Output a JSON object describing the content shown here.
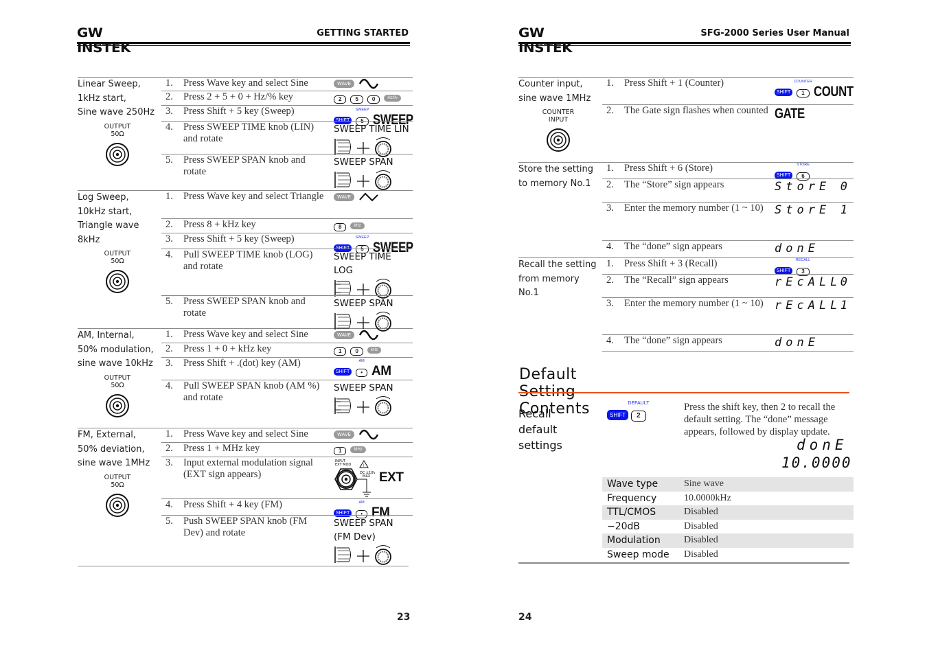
{
  "left_page": {
    "logo": "GW INSTEK",
    "header_title": "GETTING STARTED",
    "page_number": "23",
    "sections": [
      {
        "label": [
          "Linear Sweep,",
          "1kHz start,",
          "Sine wave 250Hz"
        ],
        "output": [
          "OUTPUT",
          "50Ω"
        ],
        "steps": [
          {
            "n": "1.",
            "text": "Press Wave key and select Sine",
            "icons": [
              [
                {
                  "type": "wave",
                  "label": "WAVE"
                },
                {
                  "type": "sine"
                }
              ]
            ]
          },
          {
            "n": "2.",
            "text": "Press 2 + 5 + 0 + Hz/% key",
            "icons": [
              [
                {
                  "type": "key",
                  "label": "2"
                },
                {
                  "type": "key",
                  "label": "5"
                },
                {
                  "type": "key",
                  "label": "0"
                },
                {
                  "type": "unit",
                  "label": "Hz/%"
                }
              ]
            ]
          },
          {
            "n": "3.",
            "text": "Press Shift + 5 key (Sweep)",
            "icons": [
              [
                {
                  "type": "shift",
                  "label": "SHIFT"
                },
                {
                  "type": "key",
                  "label": "5",
                  "above": "SWEEP"
                },
                {
                  "type": "big",
                  "label": "SWEEP"
                }
              ]
            ]
          },
          {
            "n": "4.",
            "text": "Press SWEEP TIME knob (LIN) and rotate",
            "icons": [
              [
                {
                  "type": "text",
                  "label": "SWEEP TIME LIN"
                }
              ],
              [
                {
                  "type": "knob"
                }
              ]
            ]
          },
          {
            "n": "5.",
            "text": "Press SWEEP SPAN knob and rotate",
            "icons": [
              [
                {
                  "type": "text",
                  "label": "SWEEP SPAN"
                }
              ],
              [
                {
                  "type": "knob"
                }
              ]
            ]
          }
        ]
      },
      {
        "label": [
          "Log Sweep,",
          "10kHz start,",
          "Triangle wave",
          "8kHz"
        ],
        "output": [
          "OUTPUT",
          "50Ω"
        ],
        "steps": [
          {
            "n": "1.",
            "text": "Press Wave key and select Triangle",
            "icons": [
              [
                {
                  "type": "wave",
                  "label": "WAVE"
                },
                {
                  "type": "triangle"
                }
              ]
            ]
          },
          {
            "n": "2.",
            "text": "Press 8 + kHz key",
            "icons": [
              [
                {
                  "type": "key",
                  "label": "8"
                },
                {
                  "type": "unit",
                  "label": "kHz"
                }
              ]
            ]
          },
          {
            "n": "3.",
            "text": "Press Shift + 5 key (Sweep)",
            "icons": [
              [
                {
                  "type": "shift",
                  "label": "SHIFT"
                },
                {
                  "type": "key",
                  "label": "5",
                  "above": "SWEEP"
                },
                {
                  "type": "big",
                  "label": "SWEEP"
                }
              ]
            ]
          },
          {
            "n": "4.",
            "text": "Pull SWEEP TIME knob (LOG) and rotate",
            "icons": [
              [
                {
                  "type": "text",
                  "label": "SWEEP TIME"
                }
              ],
              [
                {
                  "type": "text",
                  "label": "LOG"
                }
              ],
              [
                {
                  "type": "knob-pull"
                }
              ]
            ]
          },
          {
            "n": "5.",
            "text": "Press SWEEP SPAN knob and rotate",
            "icons": [
              [
                {
                  "type": "text",
                  "label": "SWEEP SPAN"
                }
              ],
              [
                {
                  "type": "knob"
                }
              ]
            ]
          }
        ]
      },
      {
        "label": [
          "AM, Internal,",
          "50% modulation,",
          "sine wave 10kHz"
        ],
        "output": [
          "OUTPUT",
          "50Ω"
        ],
        "steps": [
          {
            "n": "1.",
            "text": "Press Wave key and select Sine",
            "icons": [
              [
                {
                  "type": "wave",
                  "label": "WAVE"
                },
                {
                  "type": "sine"
                }
              ]
            ]
          },
          {
            "n": "2.",
            "text": "Press 1 + 0 + kHz key",
            "icons": [
              [
                {
                  "type": "key",
                  "label": "1"
                },
                {
                  "type": "key",
                  "label": "0"
                },
                {
                  "type": "unit",
                  "label": "kHz"
                }
              ]
            ]
          },
          {
            "n": "3.",
            "text": "Press Shift + .(dot) key (AM)",
            "icons": [
              [
                {
                  "type": "shift",
                  "label": "SHIFT"
                },
                {
                  "type": "key",
                  "label": "•",
                  "above": "AM"
                },
                {
                  "type": "bigw",
                  "label": "AM"
                }
              ]
            ]
          },
          {
            "n": "4.",
            "text": "Pull SWEEP SPAN knob (AM %) and rotate",
            "icons": [
              [
                {
                  "type": "text",
                  "label": "SWEEP SPAN"
                }
              ],
              [
                {
                  "type": "knob-pull"
                }
              ]
            ]
          }
        ]
      },
      {
        "label": [
          "FM, External,",
          "50% deviation,",
          "sine wave 1MHz"
        ],
        "output": [
          "OUTPUT",
          "50Ω"
        ],
        "steps": [
          {
            "n": "1.",
            "text": "Press Wave key and select Sine",
            "icons": [
              [
                {
                  "type": "wave",
                  "label": "WAVE"
                },
                {
                  "type": "sine"
                }
              ]
            ]
          },
          {
            "n": "2.",
            "text": "Press 1 + MHz key",
            "icons": [
              [
                {
                  "type": "key",
                  "label": "1"
                },
                {
                  "type": "unit",
                  "label": "MHz"
                }
              ]
            ]
          },
          {
            "n": "3.",
            "text": "Input external modulation signal (EXT sign appears)",
            "icons": [
              [
                {
                  "type": "ext",
                  "input": "INPUT",
                  "mod": "EXT MOD",
                  "dc": "DC ±10V",
                  "max": "MAX"
                },
                {
                  "type": "bigw",
                  "label": "EXT"
                }
              ]
            ]
          },
          {
            "n": "4.",
            "text": "Press Shift + 4 key (FM)",
            "icons": [
              [
                {
                  "type": "shift",
                  "label": "SHIFT"
                },
                {
                  "type": "key",
                  "label": "•",
                  "above": "AM"
                },
                {
                  "type": "bigw",
                  "label": "FM"
                }
              ]
            ]
          },
          {
            "n": "5.",
            "text": "Push SWEEP SPAN knob (FM Dev) and rotate",
            "icons": [
              [
                {
                  "type": "text",
                  "label": "SWEEP SPAN"
                }
              ],
              [
                {
                  "type": "text",
                  "label": "(FM Dev)"
                }
              ],
              [
                {
                  "type": "knob"
                }
              ]
            ]
          }
        ]
      }
    ]
  },
  "right_page": {
    "logo": "GW INSTEK",
    "header_title": "SFG-2000 Series User Manual",
    "page_number": "24",
    "sections": [
      {
        "label": [
          "Counter input,",
          "sine wave 1MHz"
        ],
        "output": [
          "COUNTER",
          "INPUT"
        ],
        "steps": [
          {
            "n": "1.",
            "text": "Press Shift + 1 (Counter)",
            "icons": [
              [
                {
                  "type": "shift",
                  "label": "SHIFT"
                },
                {
                  "type": "key",
                  "label": "1",
                  "above": "COUNTER"
                },
                {
                  "type": "big",
                  "label": "COUNT"
                }
              ]
            ]
          },
          {
            "n": "2.",
            "text": "The Gate sign flashes when counted",
            "icons": [
              [
                {
                  "type": "big",
                  "label": "GATE"
                }
              ]
            ]
          }
        ]
      },
      {
        "label": [
          "Store the setting",
          "to memory No.1"
        ],
        "steps": [
          {
            "n": "1.",
            "text": "Press Shift + 6 (Store)",
            "icons": [
              [
                {
                  "type": "shift",
                  "label": "SHIFT"
                },
                {
                  "type": "key",
                  "label": "6",
                  "above": "STORE"
                }
              ]
            ]
          },
          {
            "n": "2.",
            "text": "The “Store” sign appears",
            "icons": [
              [
                {
                  "type": "seg",
                  "label": "StorE",
                  "value": "0"
                }
              ]
            ]
          },
          {
            "n": "3.",
            "text": "Enter the memory number (1 ~ 10)",
            "icons": [
              [
                {
                  "type": "seg",
                  "label": "StorE",
                  "value": "1"
                }
              ]
            ]
          },
          {
            "n": "4.",
            "text": "The “done” sign appears",
            "icons": [
              [
                {
                  "type": "seg",
                  "label": "donE"
                }
              ]
            ]
          }
        ]
      },
      {
        "label": [
          "Recall the setting",
          "from memory",
          "No.1"
        ],
        "steps": [
          {
            "n": "1.",
            "text": "Press Shift + 3 (Recall)",
            "icons": [
              [
                {
                  "type": "shift",
                  "label": "SHIFT"
                },
                {
                  "type": "key",
                  "label": "3",
                  "above": "RECALL"
                }
              ]
            ]
          },
          {
            "n": "2.",
            "text": "The “Recall” sign appears",
            "icons": [
              [
                {
                  "type": "seg",
                  "label": "rEcALL",
                  "value": "0"
                }
              ]
            ]
          },
          {
            "n": "3.",
            "text": "Enter the memory number (1 ~ 10)",
            "icons": [
              [
                {
                  "type": "seg",
                  "label": "rEcALL",
                  "value": "1"
                }
              ]
            ]
          },
          {
            "n": "4.",
            "text": "The “done” sign appears",
            "icons": [
              [
                {
                  "type": "seg",
                  "label": "donE"
                }
              ]
            ]
          }
        ]
      }
    ],
    "default_section": {
      "title": "Default Setting Contents",
      "recall_label": [
        "Recall default",
        "settings"
      ],
      "shift_label": "SHIFT",
      "key_label": "2",
      "key_above": "DEFAULT",
      "description": "Press the shift key, then 2 to recall the default setting. The “done” message appears, followed by display update.",
      "display_line1": "donE",
      "display_line2": "10.0000",
      "table": [
        {
          "key": "Wave type",
          "value": "Sine wave"
        },
        {
          "key": "Frequency",
          "value": "10.0000kHz"
        },
        {
          "key": "TTL/CMOS",
          "value": "Disabled"
        },
        {
          "key": "−20dB",
          "value": "Disabled"
        },
        {
          "key": "Modulation",
          "value": "Disabled"
        },
        {
          "key": "Sweep mode",
          "value": "Disabled"
        }
      ]
    }
  },
  "colors": {
    "shift_key": "#0a14ee",
    "accent_rule": "#e8541c",
    "divider": "#8a8a8a",
    "table_shade": "#e4e4e4"
  }
}
